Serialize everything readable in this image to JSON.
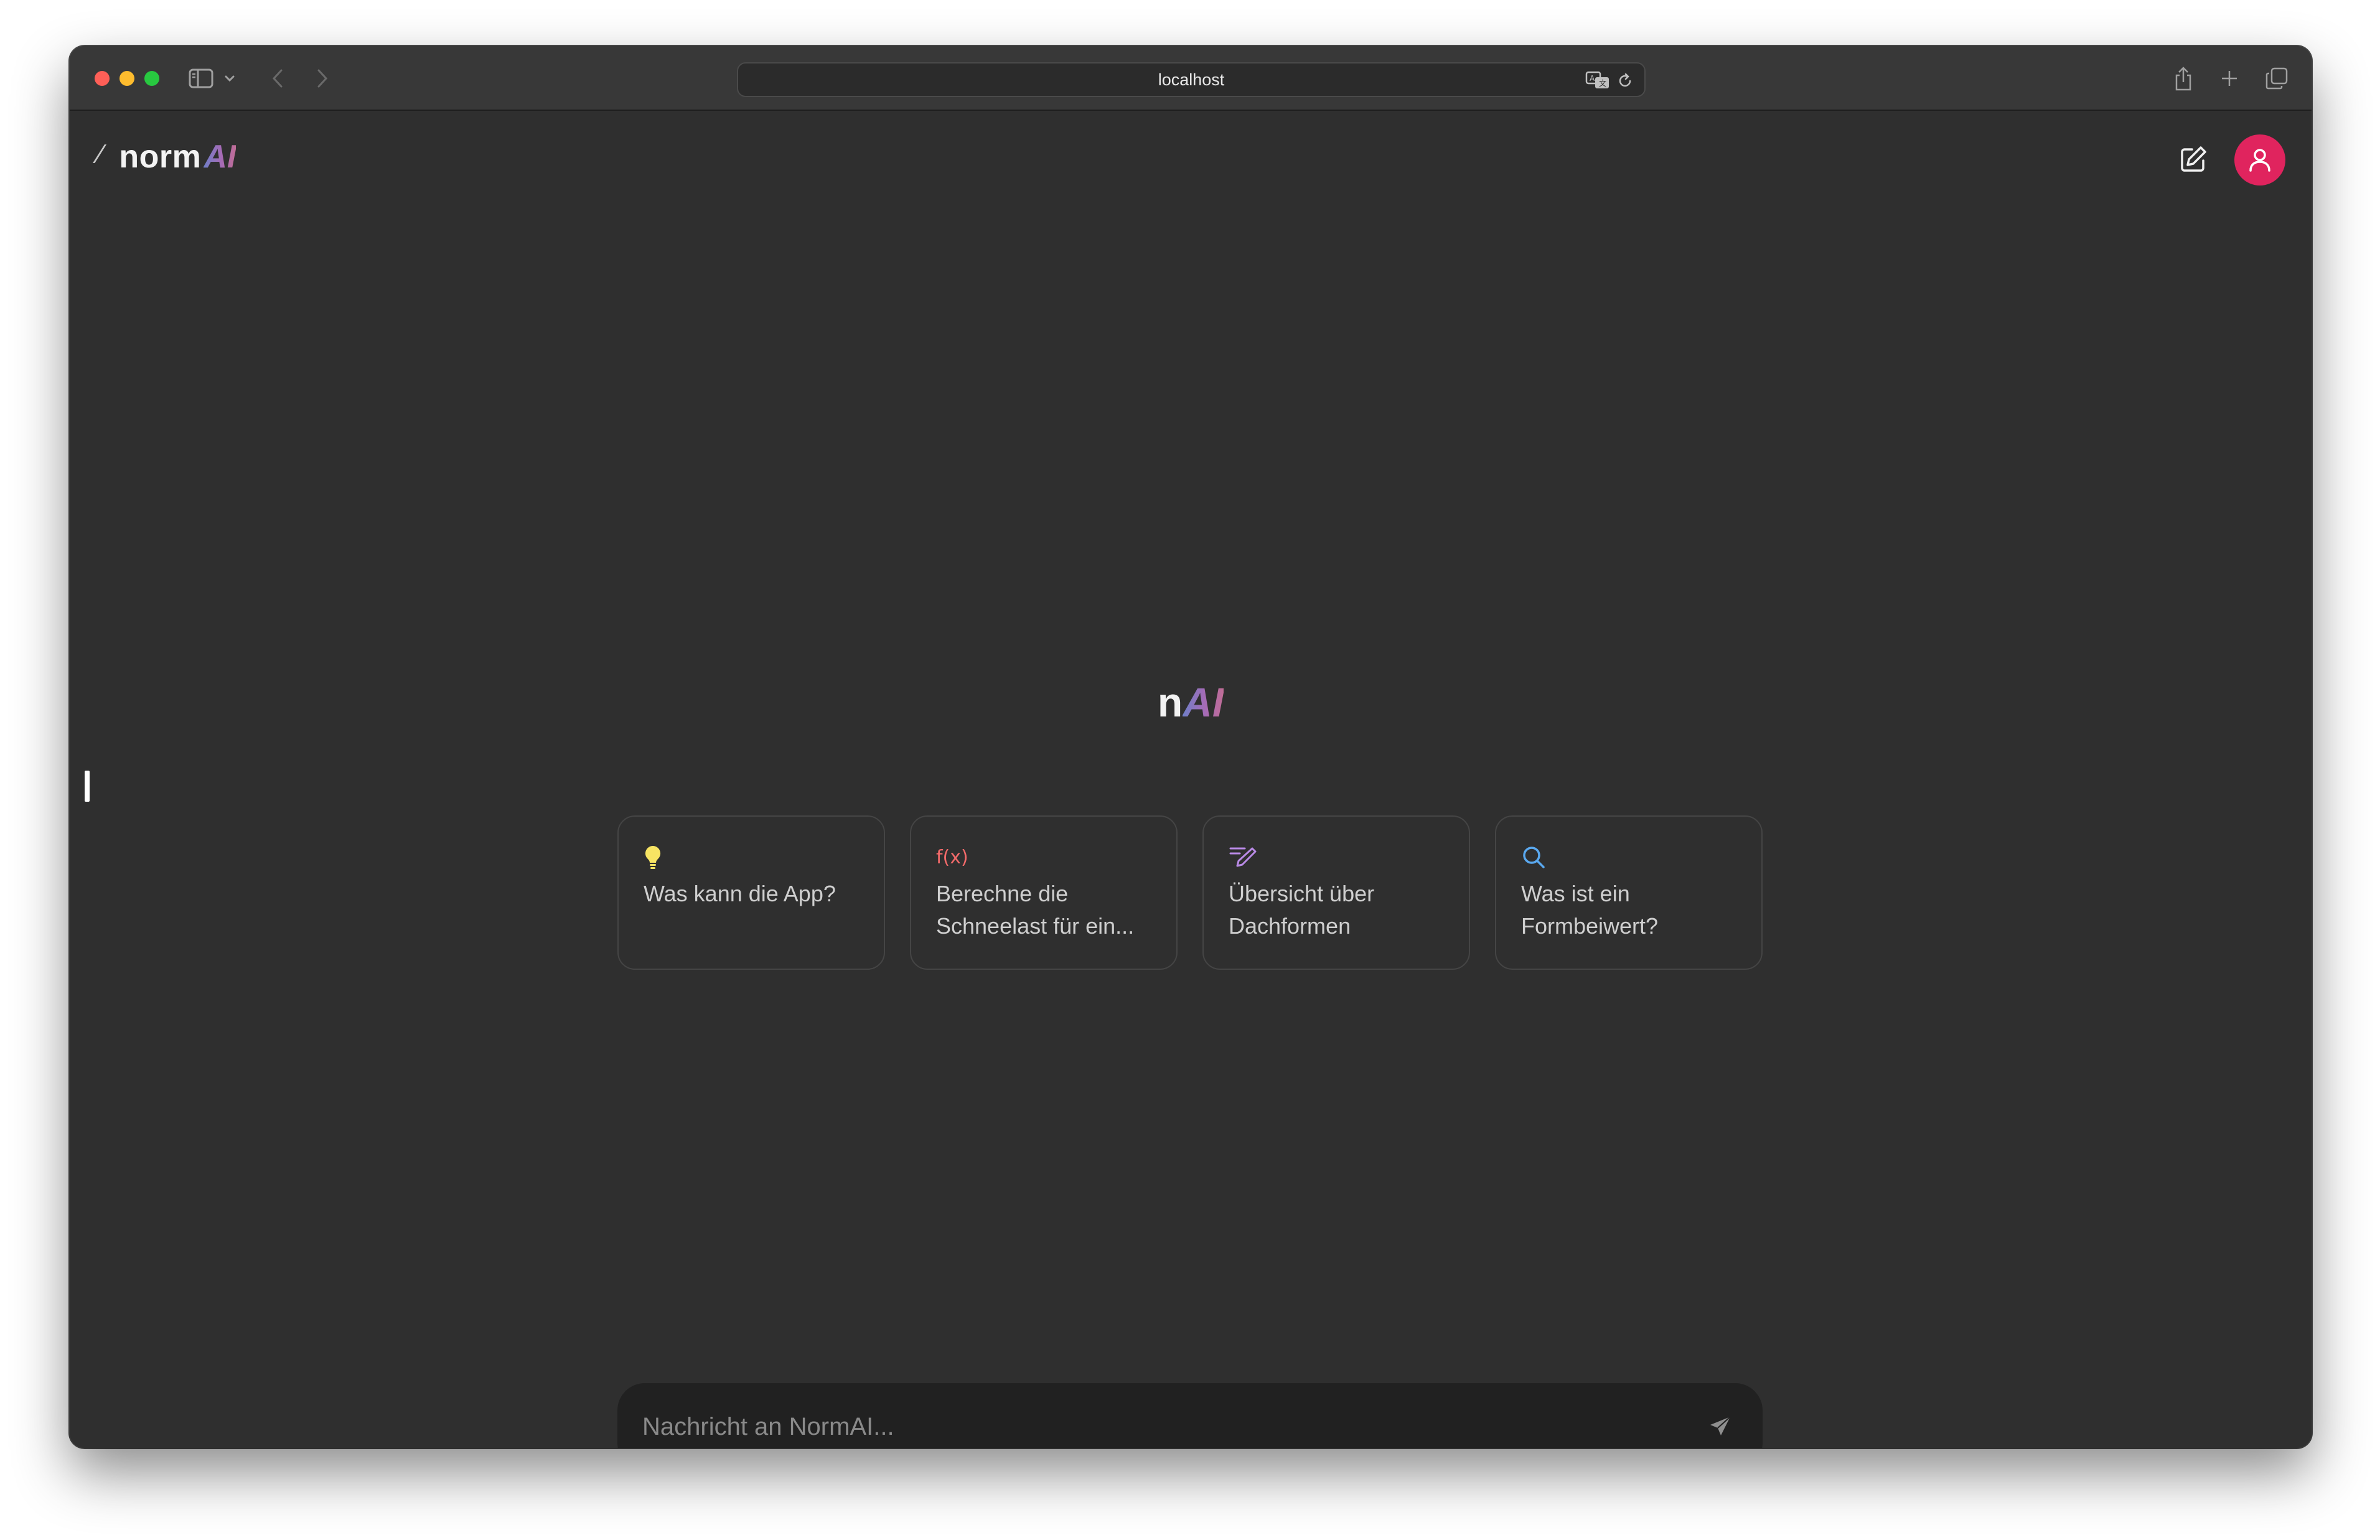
{
  "browser": {
    "url": "localhost",
    "icons": {
      "sidebar": "sidebar-icon",
      "back": "chevron-left-icon",
      "forward": "chevron-right-icon",
      "translate": "translate-icon",
      "reload": "reload-icon",
      "share": "share-icon",
      "new_tab": "plus-icon",
      "tab_overview": "tabs-icon"
    }
  },
  "app": {
    "brand": {
      "word": "norm",
      "ai": "AI"
    },
    "center_logo": {
      "n": "n",
      "ai": "AI"
    },
    "accent_gradient": [
      "#6f7fc8",
      "#a66bb6",
      "#c06d96"
    ],
    "avatar_color": "#e0245e",
    "suggestions": [
      {
        "icon": "lightbulb-icon",
        "icon_color": "#f7e463",
        "line1": "Was kann die App?",
        "line2": ""
      },
      {
        "icon": "function-icon",
        "icon_glyph": "f(x)",
        "icon_color": "#f26a6a",
        "line1": "Berechne die",
        "line2": "Schneelast für ein..."
      },
      {
        "icon": "pen-lines-icon",
        "icon_color": "#b98ae6",
        "line1": "Übersicht über",
        "line2": "Dachformen"
      },
      {
        "icon": "search-icon",
        "icon_color": "#5aa9f0",
        "line1": "Was ist ein",
        "line2": "Formbeiwert?"
      }
    ],
    "composer": {
      "placeholder": "Nachricht an NormAI..."
    }
  }
}
